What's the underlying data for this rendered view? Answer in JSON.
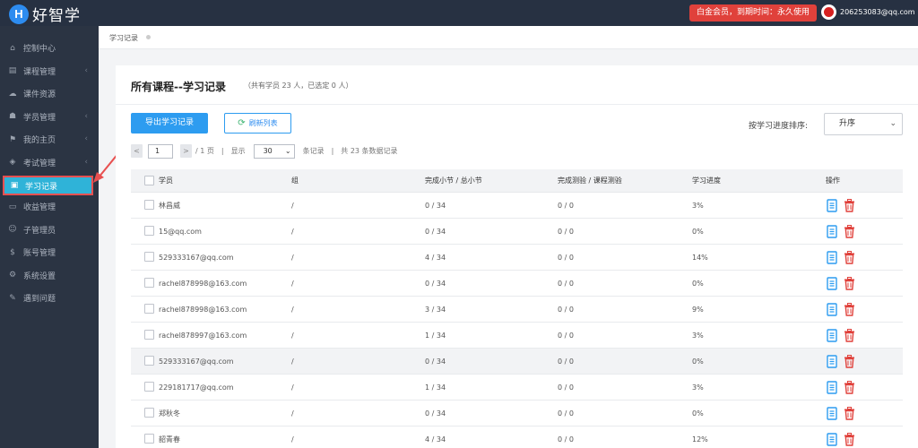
{
  "app": {
    "logo_letter": "H",
    "logo_text": "好智学",
    "member_badge": "白金会员，到期时间：永久使用",
    "user_email": "206253083@qq.com"
  },
  "sidebar": {
    "items": [
      {
        "label": "控制中心",
        "icon": "home-icon",
        "caret": false
      },
      {
        "label": "课程管理",
        "icon": "book-icon",
        "caret": true
      },
      {
        "label": "课件资源",
        "icon": "cloud-icon",
        "caret": false
      },
      {
        "label": "学员管理",
        "icon": "users-icon",
        "caret": true
      },
      {
        "label": "我的主页",
        "icon": "flag-icon",
        "caret": true
      },
      {
        "label": "考试管理",
        "icon": "tag-icon",
        "caret": true
      },
      {
        "label": "学习记录",
        "icon": "notebook-icon",
        "caret": false,
        "active": true
      },
      {
        "label": "收益管理",
        "icon": "card-icon",
        "caret": false
      },
      {
        "label": "子管理员",
        "icon": "user-icon",
        "caret": false
      },
      {
        "label": "账号管理",
        "icon": "dollar-icon",
        "caret": false
      },
      {
        "label": "系统设置",
        "icon": "gear-icon",
        "caret": false
      },
      {
        "label": "遇到问题",
        "icon": "pin-icon",
        "caret": false
      }
    ]
  },
  "breadcrumb": {
    "current": "学习记录"
  },
  "panel": {
    "title": "所有课程--学习记录",
    "subtitle": "（共有学员 23 人，已选定 0 人）",
    "export_button": "导出学习记录",
    "refresh_button": "刷新列表",
    "sort_label": "按学习进度排序:",
    "sort_value": "升序"
  },
  "pager": {
    "prev": "<",
    "next": ">",
    "page": "1",
    "of_pages": "/ 1 页",
    "sep1": "|",
    "show": "显示",
    "page_size": "30",
    "per": "条记录",
    "sep2": "|",
    "total": "共 23 条数据记录"
  },
  "table": {
    "headers": {
      "name": "学员",
      "group": "组",
      "sections": "完成小节 / 总小节",
      "quizzes": "完成测验 / 课程测验",
      "progress": "学习进度",
      "ops": "操作"
    },
    "rows": [
      {
        "name": "林昌威",
        "group": "/",
        "sections": "0 / 34",
        "quizzes": "0 / 0",
        "progress": "3%"
      },
      {
        "name": "15@qq.com",
        "group": "/",
        "sections": "0 / 34",
        "quizzes": "0 / 0",
        "progress": "0%"
      },
      {
        "name": "529333167@qq.com",
        "group": "/",
        "sections": "4 / 34",
        "quizzes": "0 / 0",
        "progress": "14%"
      },
      {
        "name": "rachel878998@163.com",
        "group": "/",
        "sections": "0 / 34",
        "quizzes": "0 / 0",
        "progress": "0%"
      },
      {
        "name": "rachel878998@163.com",
        "group": "/",
        "sections": "3 / 34",
        "quizzes": "0 / 0",
        "progress": "9%"
      },
      {
        "name": "rachel878997@163.com",
        "group": "/",
        "sections": "1 / 34",
        "quizzes": "0 / 0",
        "progress": "3%"
      },
      {
        "name": "529333167@qq.com",
        "group": "/",
        "sections": "0 / 34",
        "quizzes": "0 / 0",
        "progress": "0%",
        "highlight": true
      },
      {
        "name": "229181717@qq.com",
        "group": "/",
        "sections": "1 / 34",
        "quizzes": "0 / 0",
        "progress": "3%"
      },
      {
        "name": "郑秋冬",
        "group": "/",
        "sections": "0 / 34",
        "quizzes": "0 / 0",
        "progress": "0%"
      },
      {
        "name": "韶青春",
        "group": "/",
        "sections": "4 / 34",
        "quizzes": "0 / 0",
        "progress": "12%"
      }
    ]
  },
  "colors": {
    "topbar": "#273142",
    "sidebar": "#2b3443",
    "active_item": "#2fb3d8",
    "primary": "#2d9cf0",
    "danger": "#e0413b",
    "annotation": "#e85050"
  }
}
